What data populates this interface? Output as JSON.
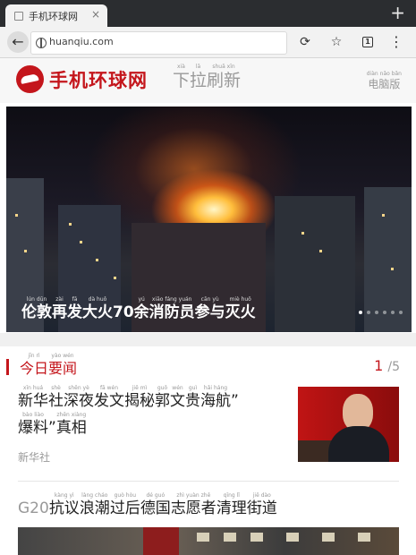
{
  "browser": {
    "tab_title": "手机环球网",
    "tab_close": "×",
    "new_tab": "+",
    "url": "huanqiu.com",
    "tab_count": "1"
  },
  "site": {
    "logo_text": "手机环球网",
    "pull_refresh": [
      {
        "py": "xià",
        "hz": "下"
      },
      {
        "py": "lā",
        "hz": "拉"
      },
      {
        "py": "shuā xīn",
        "hz": "刷新"
      }
    ],
    "desktop_version": {
      "py": "diàn nǎo bǎn",
      "hz": "电脑版"
    }
  },
  "hero": {
    "caption": [
      {
        "py": "lún dūn",
        "hz": "伦敦"
      },
      {
        "py": "zài",
        "hz": "再"
      },
      {
        "py": "fā",
        "hz": "发"
      },
      {
        "py": "dà huǒ",
        "hz": "大火"
      },
      {
        "py": "",
        "hz": "70"
      },
      {
        "py": "yú",
        "hz": "余"
      },
      {
        "py": "xiāo fáng yuán",
        "hz": "消防员"
      },
      {
        "py": "cān yù",
        "hz": "参与"
      },
      {
        "py": "miè huǒ",
        "hz": "灭火"
      }
    ],
    "slides": 6,
    "active_slide": 0
  },
  "today": {
    "title": [
      {
        "py": "jīn rì",
        "hz": "今日"
      },
      {
        "py": "yào wén",
        "hz": "要闻"
      }
    ],
    "page_current": "1",
    "page_total": "/5"
  },
  "articles": [
    {
      "line1": [
        {
          "py": "xīn huá",
          "hz": "新华"
        },
        {
          "py": "shè",
          "hz": "社"
        },
        {
          "py": "shēn yè",
          "hz": "深夜"
        },
        {
          "py": "fā wén",
          "hz": "发文"
        },
        {
          "py": "jiē mì",
          "hz": "揭秘"
        },
        {
          "py": "guō",
          "hz": "郭"
        },
        {
          "py": "wén",
          "hz": "文"
        },
        {
          "py": "guì",
          "hz": "贵"
        },
        {
          "py": "hǎi háng",
          "hz": "海航"
        },
        {
          "py": "",
          "hz": "”"
        }
      ],
      "line2": [
        {
          "py": "bào liào",
          "hz": "爆料"
        },
        {
          "py": "",
          "hz": "”"
        },
        {
          "py": "zhēn xiàng",
          "hz": "真相"
        }
      ],
      "source": "新华社"
    },
    {
      "line1": [
        {
          "py": "",
          "hz": "G20"
        },
        {
          "py": "kàng yì",
          "hz": "抗议"
        },
        {
          "py": "làng cháo",
          "hz": "浪潮"
        },
        {
          "py": "guò hòu",
          "hz": "过后"
        },
        {
          "py": "dé guó",
          "hz": "德国"
        },
        {
          "py": "zhì yuàn zhě",
          "hz": "志愿者"
        },
        {
          "py": "qīng lǐ",
          "hz": "清理"
        },
        {
          "py": "jiē dào",
          "hz": "街道"
        }
      ]
    }
  ]
}
